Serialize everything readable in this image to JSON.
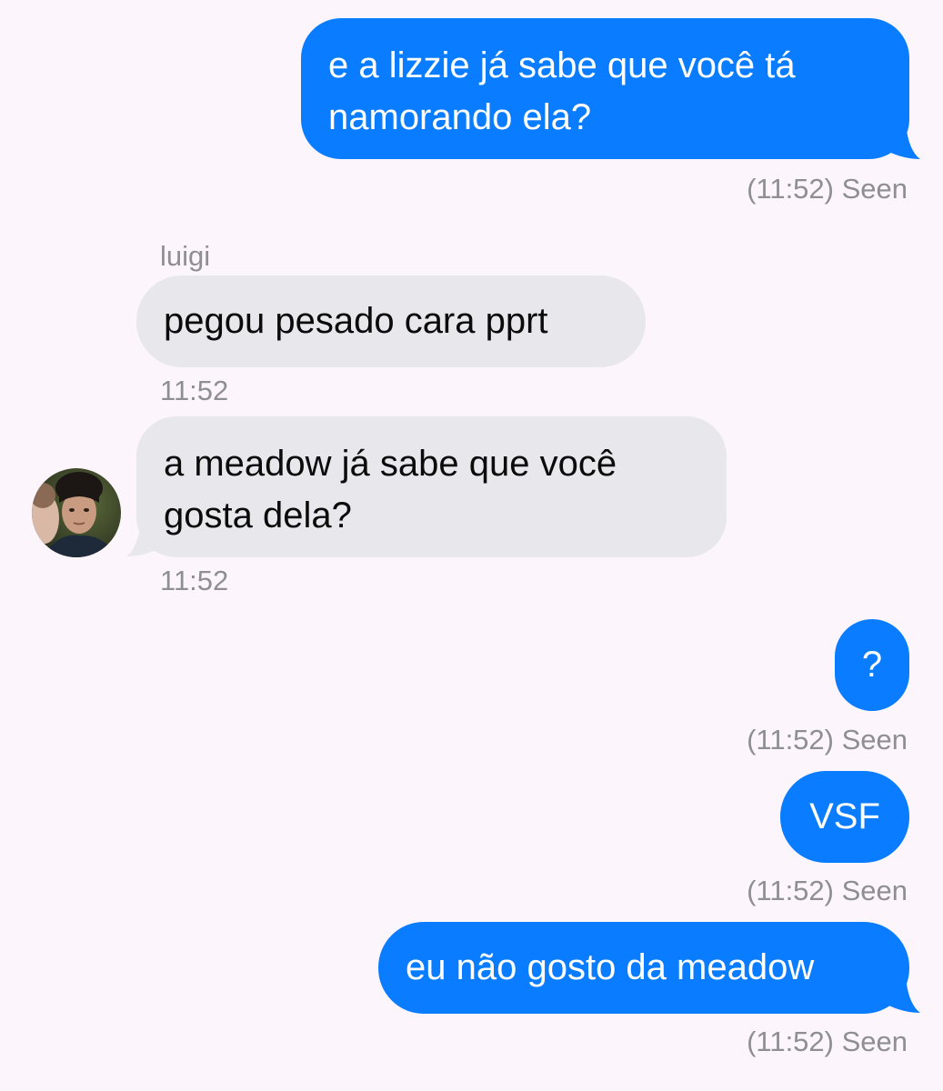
{
  "theme": {
    "outgoing_bubble": "#0a7cff",
    "incoming_bubble": "#e7e7ec",
    "background": "#fcf6fc",
    "meta_text": "#8e8e93"
  },
  "messages": [
    {
      "direction": "outgoing",
      "lines": [
        "e a lizzie já sabe que você tá",
        "namorando ela?"
      ],
      "status": "(11:52) Seen"
    },
    {
      "direction": "incoming",
      "sender": "luigi",
      "lines": [
        "pegou pesado cara pprt"
      ],
      "time": "11:52"
    },
    {
      "direction": "incoming",
      "avatar_icon": "profile-photo",
      "lines": [
        "a meadow já sabe que você",
        "gosta dela?"
      ],
      "time": "11:52"
    },
    {
      "direction": "outgoing",
      "lines": [
        "?"
      ],
      "status": "(11:52) Seen"
    },
    {
      "direction": "outgoing",
      "lines": [
        "VSF"
      ],
      "status": "(11:52) Seen"
    },
    {
      "direction": "outgoing",
      "lines": [
        "eu não gosto da meadow"
      ],
      "status": "(11:52) Seen"
    }
  ]
}
